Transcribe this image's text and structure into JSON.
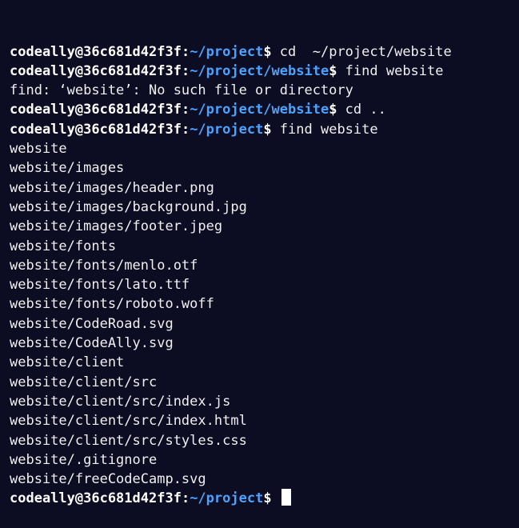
{
  "prompt": {
    "user_host": "codeally@36c681d42f3f",
    "separator": ":",
    "dollar": "$"
  },
  "lines": [
    {
      "type": "prompt",
      "path": "~/project",
      "command": " cd  ~/project/website"
    },
    {
      "type": "prompt",
      "path": "~/project/website",
      "command": " find website"
    },
    {
      "type": "output",
      "text": "find: ‘website’: No such file or directory"
    },
    {
      "type": "prompt",
      "path": "~/project/website",
      "command": " cd .."
    },
    {
      "type": "prompt",
      "path": "~/project",
      "command": " find website"
    },
    {
      "type": "output",
      "text": "website"
    },
    {
      "type": "output",
      "text": "website/images"
    },
    {
      "type": "output",
      "text": "website/images/header.png"
    },
    {
      "type": "output",
      "text": "website/images/background.jpg"
    },
    {
      "type": "output",
      "text": "website/images/footer.jpeg"
    },
    {
      "type": "output",
      "text": "website/fonts"
    },
    {
      "type": "output",
      "text": "website/fonts/menlo.otf"
    },
    {
      "type": "output",
      "text": "website/fonts/lato.ttf"
    },
    {
      "type": "output",
      "text": "website/fonts/roboto.woff"
    },
    {
      "type": "output",
      "text": "website/CodeRoad.svg"
    },
    {
      "type": "output",
      "text": "website/CodeAlly.svg"
    },
    {
      "type": "output",
      "text": "website/client"
    },
    {
      "type": "output",
      "text": "website/client/src"
    },
    {
      "type": "output",
      "text": "website/client/src/index.js"
    },
    {
      "type": "output",
      "text": "website/client/src/index.html"
    },
    {
      "type": "output",
      "text": "website/client/src/styles.css"
    },
    {
      "type": "output",
      "text": "website/.gitignore"
    },
    {
      "type": "output",
      "text": "website/freeCodeCamp.svg"
    },
    {
      "type": "prompt",
      "path": "~/project",
      "command": " ",
      "cursor": true
    }
  ],
  "colors": {
    "background": "#0c0c23",
    "path": "#4aa3ff",
    "text": "#f0f0f0"
  }
}
